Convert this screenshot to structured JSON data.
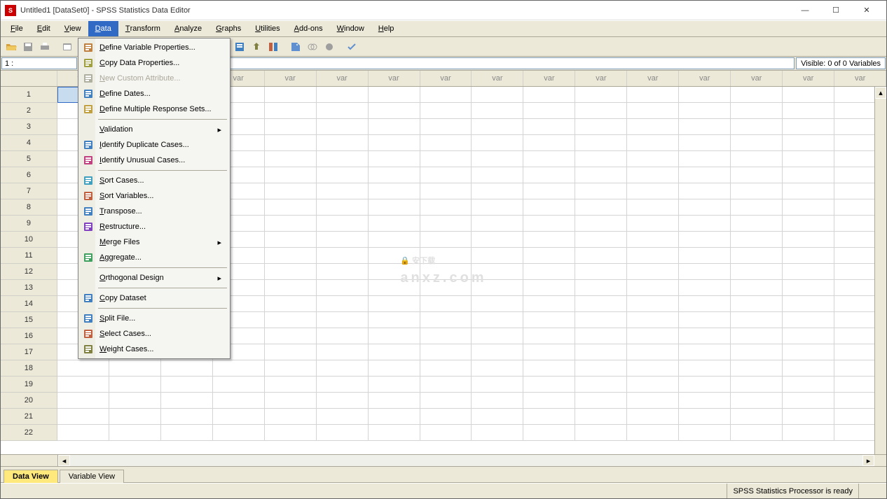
{
  "title": "Untitled1 [DataSet0] - SPSS Statistics Data Editor",
  "window_controls": {
    "min": "—",
    "max": "☐",
    "close": "✕"
  },
  "menubar": [
    "File",
    "Edit",
    "View",
    "Data",
    "Transform",
    "Analyze",
    "Graphs",
    "Utilities",
    "Add-ons",
    "Window",
    "Help"
  ],
  "menubar_active": "Data",
  "cellref": "1 :",
  "visible_label": "Visible: 0 of 0 Variables",
  "col_label": "var",
  "num_cols": 16,
  "num_rows": 22,
  "tabs": {
    "data": "Data View",
    "variable": "Variable View"
  },
  "statusbar": "SPSS Statistics Processor is ready",
  "menu": {
    "items": [
      {
        "label": "Define Variable Properties...",
        "icon": "define-var-icon",
        "iconColor": "#c08040"
      },
      {
        "label": "Copy Data Properties...",
        "icon": "copy-data-icon",
        "iconColor": "#a0a040"
      },
      {
        "label": "New Custom Attribute...",
        "icon": "new-attr-icon",
        "disabled": true,
        "iconColor": "#b0b0a0"
      },
      {
        "label": "Define Dates...",
        "icon": "dates-icon",
        "iconColor": "#4080c0"
      },
      {
        "label": "Define Multiple Response Sets...",
        "icon": "mrs-icon",
        "iconColor": "#c0a040"
      },
      {
        "sep": true
      },
      {
        "label": "Validation",
        "submenu": true
      },
      {
        "label": "Identify Duplicate Cases...",
        "icon": "dup-icon",
        "iconColor": "#4080c0"
      },
      {
        "label": "Identify Unusual Cases...",
        "icon": "unusual-icon",
        "iconColor": "#c04080"
      },
      {
        "sep": true
      },
      {
        "label": "Sort Cases...",
        "icon": "sort-cases-icon",
        "iconColor": "#40a0c0"
      },
      {
        "label": "Sort Variables...",
        "icon": "sort-var-icon",
        "iconColor": "#c06040"
      },
      {
        "label": "Transpose...",
        "icon": "transpose-icon",
        "iconColor": "#4080c0"
      },
      {
        "label": "Restructure...",
        "icon": "restructure-icon",
        "iconColor": "#8040c0"
      },
      {
        "label": "Merge Files",
        "submenu": true
      },
      {
        "label": "Aggregate...",
        "icon": "aggregate-icon",
        "iconColor": "#40a060"
      },
      {
        "sep": true
      },
      {
        "label": "Orthogonal Design",
        "submenu": true
      },
      {
        "sep": true
      },
      {
        "label": "Copy Dataset",
        "icon": "copy-ds-icon",
        "iconColor": "#4080c0"
      },
      {
        "sep": true
      },
      {
        "label": "Split File...",
        "icon": "split-icon",
        "iconColor": "#4080c0"
      },
      {
        "label": "Select Cases...",
        "icon": "select-icon",
        "iconColor": "#c06040"
      },
      {
        "label": "Weight Cases...",
        "icon": "weight-icon",
        "iconColor": "#808040"
      }
    ]
  },
  "watermark": {
    "main": "🔒 安下载",
    "sub": "anxz.com"
  }
}
